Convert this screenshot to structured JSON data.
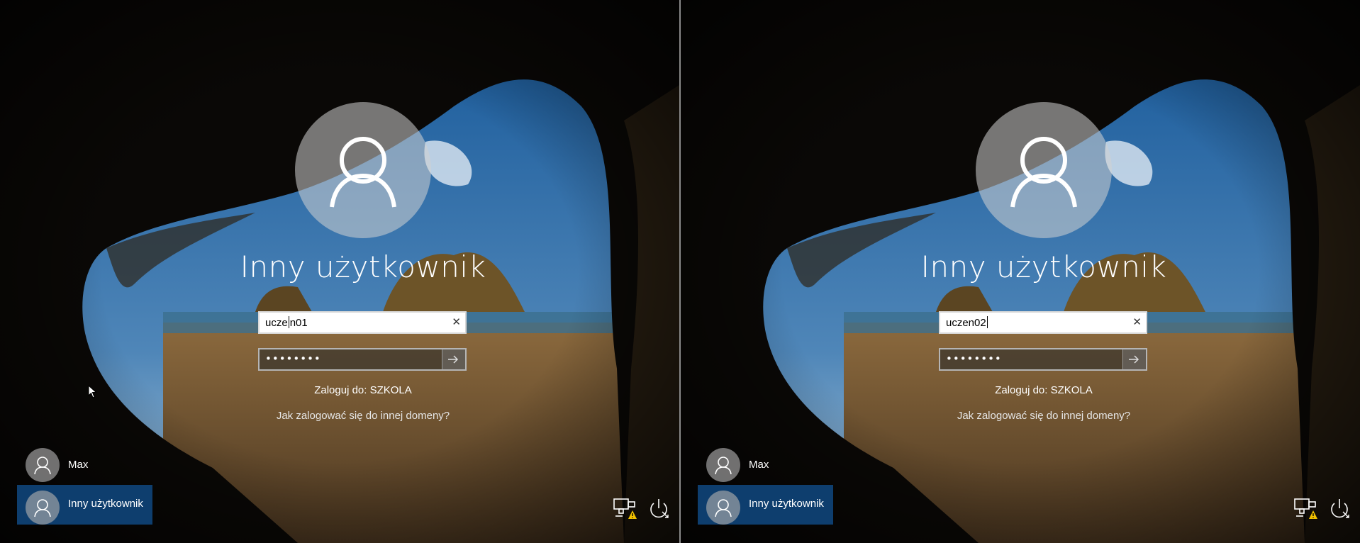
{
  "screens": [
    {
      "user_title": "Inny użytkownik",
      "username_before_caret": "ucze",
      "username_after_caret": "n01",
      "password_mask": "••••••••",
      "signin_to": "Zaloguj do: SZKOLA",
      "other_domain_link": "Jak zalogować się do innej domeny?",
      "users": [
        {
          "name": "Max"
        },
        {
          "name": "Inny użytkownik",
          "selected": true
        }
      ]
    },
    {
      "user_title": "Inny użytkownik",
      "username_before_caret": "uczen02",
      "username_after_caret": "",
      "password_mask": "••••••••",
      "signin_to": "Zaloguj do: SZKOLA",
      "other_domain_link": "Jak zalogować się do innej domeny?",
      "users": [
        {
          "name": "Max"
        },
        {
          "name": "Inny użytkownik",
          "selected": true
        }
      ]
    }
  ],
  "icons": {
    "clear": "close-icon",
    "submit": "arrow-right-icon",
    "network": "network-warning-icon",
    "power": "power-icon",
    "user": "user-icon"
  },
  "colors": {
    "selected_tile": "#0e3e6e",
    "warning": "#f2c200"
  }
}
